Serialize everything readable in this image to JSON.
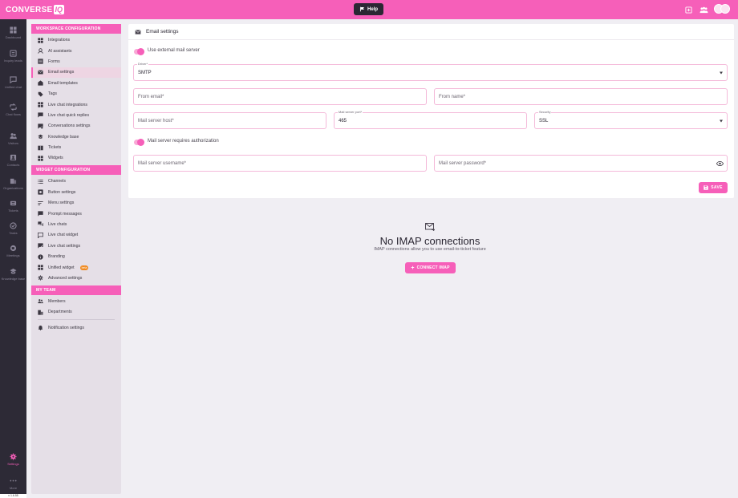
{
  "app": {
    "logo_text": "CONVERSE",
    "logo_badge": "IQ",
    "help_label": "Help",
    "version": "v 1.6.55"
  },
  "rail": [
    {
      "label": "Dashboard",
      "icon": "dashboard-icon"
    },
    {
      "label": "Inquiry leads",
      "icon": "leads-icon"
    },
    {
      "label": "Unified chat",
      "icon": "chat-icon"
    },
    {
      "label": "Chat flows",
      "icon": "flows-icon"
    },
    {
      "label": "Visitors",
      "icon": "visitors-icon"
    },
    {
      "label": "Contacts",
      "icon": "contacts-icon"
    },
    {
      "label": "Organizations",
      "icon": "organizations-icon"
    },
    {
      "label": "Tickets",
      "icon": "tickets-icon"
    },
    {
      "label": "Tasks",
      "icon": "tasks-icon"
    },
    {
      "label": "Meetings",
      "icon": "meetings-icon"
    },
    {
      "label": "Knowledge base",
      "icon": "knowledge-icon"
    },
    {
      "label": "Settings",
      "icon": "gear-icon",
      "active": true
    },
    {
      "label": "More",
      "icon": "more-icon"
    }
  ],
  "sidebar": {
    "workspace_header": "WORKSPACE CONFIGURATION",
    "workspace_items": [
      {
        "label": "Integrations"
      },
      {
        "label": "AI assistants"
      },
      {
        "label": "Forms"
      },
      {
        "label": "Email settings",
        "active": true
      },
      {
        "label": "Email templates"
      },
      {
        "label": "Tags"
      },
      {
        "label": "Live chat integrations"
      },
      {
        "label": "Live chat quick replies"
      },
      {
        "label": "Conversations settings"
      },
      {
        "label": "Knowledge base"
      },
      {
        "label": "Tickets"
      },
      {
        "label": "Widgets"
      }
    ],
    "widget_header": "WIDGET CONFIGURATION",
    "widget_items": [
      {
        "label": "Channels"
      },
      {
        "label": "Button settings"
      },
      {
        "label": "Menu settings"
      },
      {
        "label": "Prompt messages"
      },
      {
        "label": "Live chats"
      },
      {
        "label": "Live chat widget"
      },
      {
        "label": "Live chat settings"
      },
      {
        "label": "Branding"
      },
      {
        "label": "Unified widget",
        "badge": "beta"
      },
      {
        "label": "Advanced settings"
      }
    ],
    "team_header": "MY TEAM",
    "team_items": [
      {
        "label": "Members"
      },
      {
        "label": "Departments"
      }
    ],
    "notification_label": "Notification settings"
  },
  "email_settings": {
    "title": "Email settings",
    "use_external_label": "Use external mail server",
    "use_external_on": true,
    "driver_label": "Driver*",
    "driver_value": "SMTP",
    "from_email_placeholder": "From email*",
    "from_name_placeholder": "From name*",
    "host_placeholder": "Mail server host*",
    "port_label": "Mail server port*",
    "port_value": "465",
    "security_label": "Security",
    "security_value": "SSL",
    "requires_auth_label": "Mail server requires authorization",
    "requires_auth_on": true,
    "username_placeholder": "Mail server username*",
    "password_placeholder": "Mail server password*",
    "save_label": "SAVE"
  },
  "imap": {
    "empty_title": "No IMAP connections",
    "empty_sub": "IMAP connections allow you to use email-to-ticket feature",
    "connect_label": "CONNECT IMAP"
  },
  "colors": {
    "accent": "#f65fb9",
    "rail_bg": "#2d2a36",
    "sidebar_bg": "#e5dfe7",
    "page_bg": "#f0eef3"
  }
}
